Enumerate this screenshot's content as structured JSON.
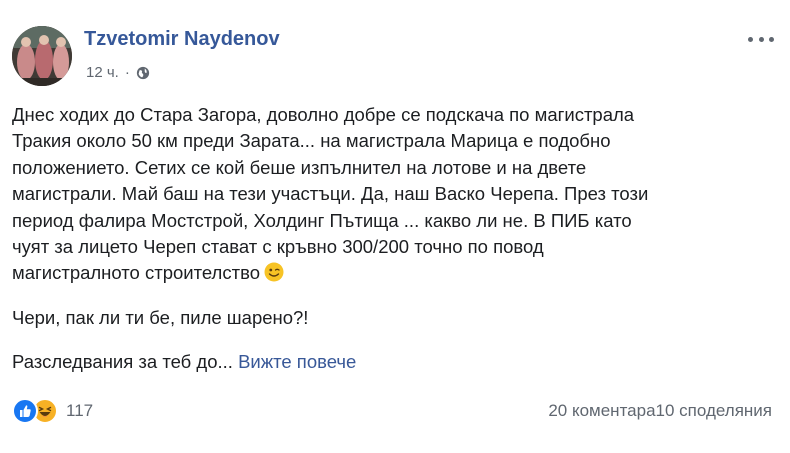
{
  "post": {
    "author": "Tzvetomir Naydenov",
    "timestamp": "12 ч.",
    "separator": "·",
    "privacy_icon": "globe-icon",
    "menu_icon": "more-options-icon",
    "paragraphs": {
      "p1": "Днес ходих до Стара Загора, доволно добре се подскача по магистрала\nТракия около 50 км преди Зарата... на магистрала Марица е подобно\nположението. Сетих се кой беше изпълнител на лотове и на двете\nмагистрали. Май баш на тези участъци. Да, наш Васко Черепа. През този\nпериод фалира Мостстрой, Холдинг Пътища ... какво ли не. В ПИБ като\nчуят за лицето Череп стават с кръвно 300/200 точно по повод\nмагистралното строителство",
      "p1_emoji": "wink-emoji",
      "p2": "Чери, пак ли ти бе, пиле шарено?!",
      "p3": "Разследвания за теб до...",
      "see_more": "Вижте повече"
    },
    "reactions": {
      "icons": [
        "like-icon",
        "haha-icon"
      ],
      "count": "117"
    },
    "stats": {
      "comments": "20 коментара",
      "shares": "10 споделяния"
    },
    "colors": {
      "author": "#365899",
      "link": "#385898",
      "meta": "#606770",
      "like": "#1877f2",
      "haha": "#f7b125"
    }
  }
}
